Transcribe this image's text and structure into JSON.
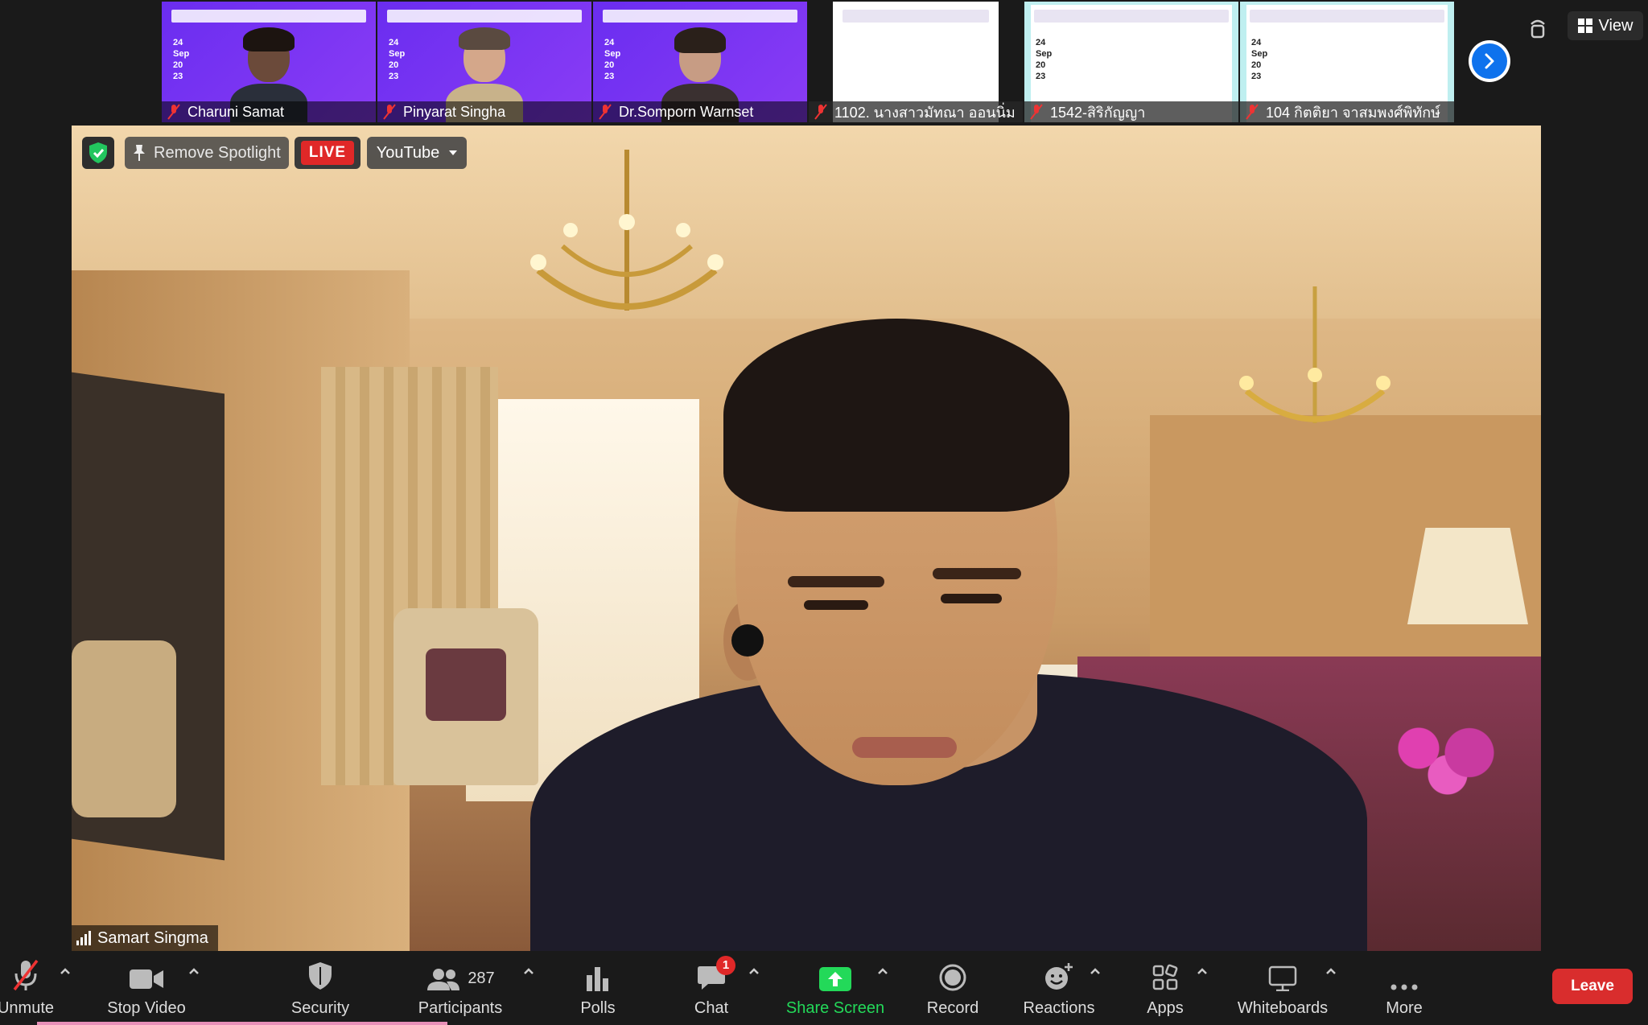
{
  "top_strip": {
    "thumbnails": [
      {
        "name": "Charuni Samat",
        "date_lines": [
          "24",
          "Sep",
          "20",
          "23"
        ],
        "slide": "purple"
      },
      {
        "name": "Pinyarat Singha",
        "date_lines": [
          "24",
          "Sep",
          "20",
          "23"
        ],
        "slide": "purple"
      },
      {
        "name": "Dr.Somporn Warnset",
        "date_lines": [
          "24",
          "Sep",
          "20",
          "23"
        ],
        "slide": "purple"
      },
      {
        "name": "1102. นางสาวมัทณา ออนนิ่ม",
        "date_lines": [],
        "slide": "white"
      },
      {
        "name": "1542-สิริกัญญา",
        "date_lines": [
          "24",
          "Sep",
          "20",
          "23"
        ],
        "slide": "cyan"
      },
      {
        "name": "104 กิตติยา จาสมพงศ์พิทักษ์",
        "date_lines": [
          "24",
          "Sep",
          "20",
          "23"
        ],
        "slide": "cyan"
      }
    ],
    "next_icon": "chevron-right-icon",
    "view_label": "View"
  },
  "main_video": {
    "speaker_name": "Samart Singma",
    "remove_spotlight_label": "Remove Spotlight",
    "live_label": "LIVE",
    "stream_label": "YouTube"
  },
  "toolbar": {
    "items": [
      {
        "label": "Unmute",
        "icon": "microphone-muted-icon"
      },
      {
        "label": "Stop Video",
        "icon": "video-camera-icon"
      },
      {
        "label": "Security",
        "icon": "shield-icon"
      },
      {
        "label": "Participants",
        "icon": "participants-icon",
        "count": "287"
      },
      {
        "label": "Polls",
        "icon": "polls-icon"
      },
      {
        "label": "Chat",
        "icon": "chat-icon",
        "badge": "1"
      },
      {
        "label": "Share Screen",
        "icon": "share-screen-icon"
      },
      {
        "label": "Record",
        "icon": "record-icon"
      },
      {
        "label": "Reactions",
        "icon": "reactions-icon"
      },
      {
        "label": "Apps",
        "icon": "apps-icon"
      },
      {
        "label": "Whiteboards",
        "icon": "whiteboard-icon"
      },
      {
        "label": "More",
        "icon": "more-icon"
      }
    ],
    "leave_label": "Leave"
  },
  "colors": {
    "accent_blue": "#0e72ed",
    "share_green": "#23d959",
    "leave_red": "#d92d2d",
    "live_red": "#e02828"
  }
}
